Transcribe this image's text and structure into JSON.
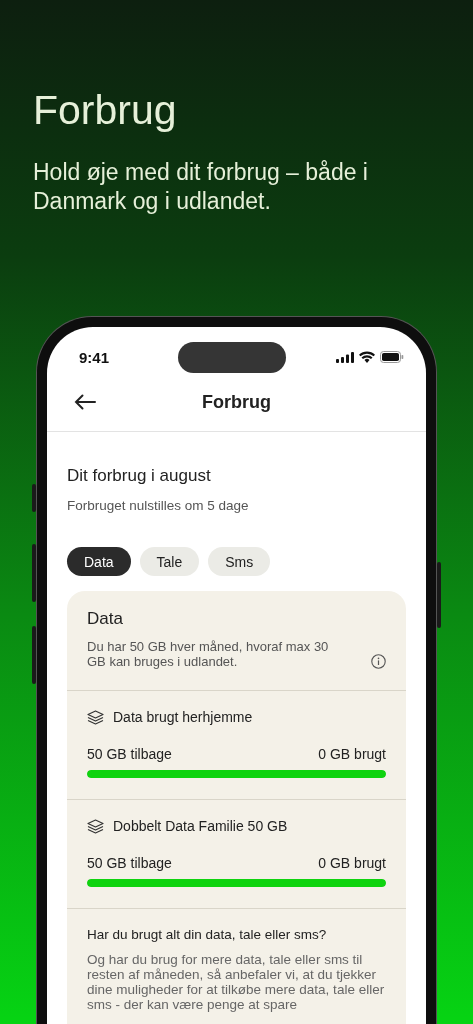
{
  "headline": "Forbrug",
  "subtitle": "Hold øje med dit forbrug – både i Danmark og i udlandet.",
  "status_bar": {
    "time": "9:41"
  },
  "nav": {
    "title": "Forbrug"
  },
  "period": {
    "title": "Dit forbrug i august",
    "subtitle": "Forbruget nulstilles om 5 dage"
  },
  "tabs": [
    {
      "label": "Data",
      "selected": true
    },
    {
      "label": "Tale",
      "selected": false
    },
    {
      "label": "Sms",
      "selected": false
    }
  ],
  "card": {
    "title": "Data",
    "description": "Du har 50 GB hver måned, hvoraf max 30 GB kan bruges i udlandet.",
    "meters": [
      {
        "name": "Data brugt herhjemme",
        "remaining": "50 GB tilbage",
        "used": "0 GB brugt",
        "level": 1
      },
      {
        "name": "Dobbelt Data Familie 50 GB",
        "remaining": "50 GB tilbage",
        "used": "0 GB brugt",
        "level": 1
      }
    ],
    "tip": {
      "title": "Har du brugt alt din data, tale eller sms?",
      "text": "Og har du brug for mere data, tale eller sms til resten af måneden, så anbefaler vi, at du tjekker dine muligheder for at tilkøbe mere data, tale eller sms - der kan være penge at spare"
    }
  }
}
